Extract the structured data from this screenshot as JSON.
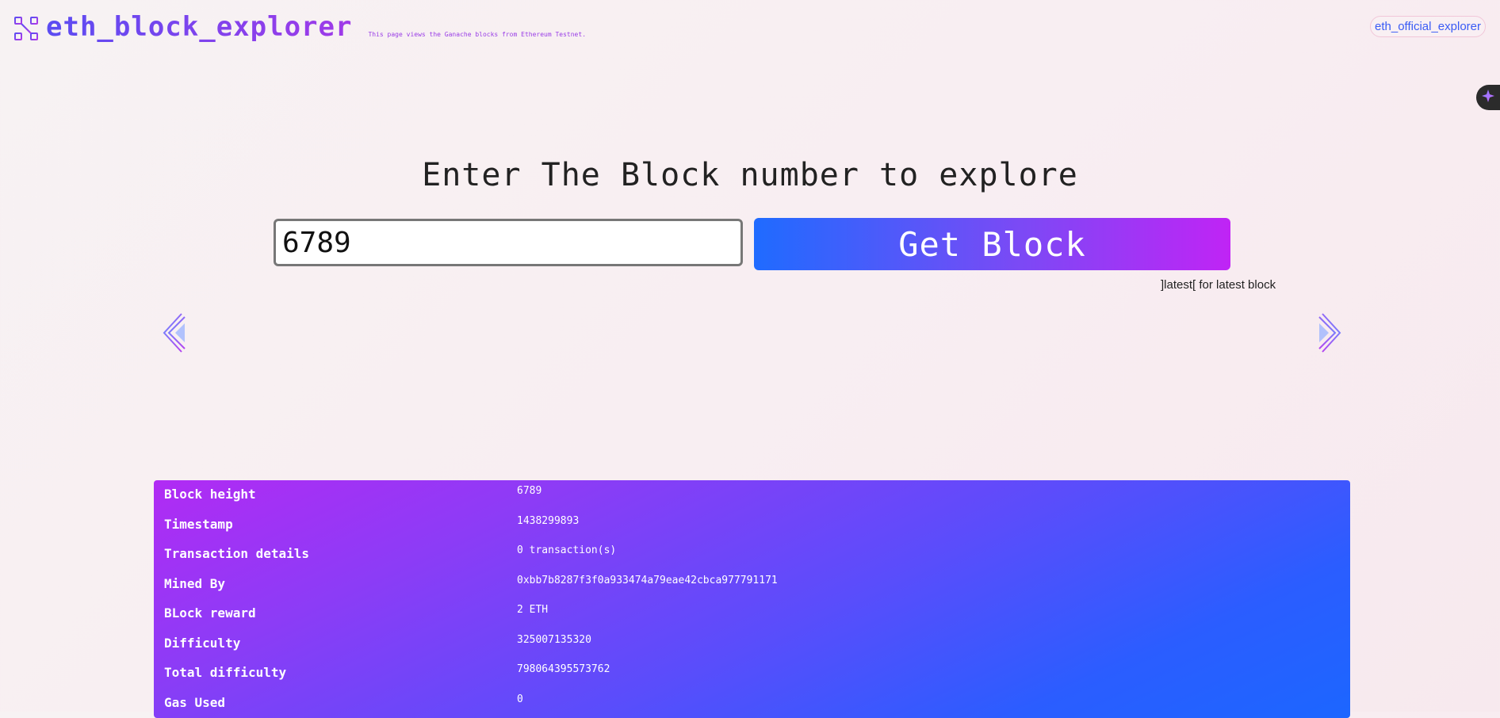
{
  "header": {
    "brand": "eth_block_explorer",
    "subtitle": "This page views the Ganache blocks from Ethereum Testnet.",
    "official_link": "eth_official_explorer"
  },
  "hero": {
    "title": "Enter The Block number to explore",
    "input_value": "6789",
    "button_label": "Get Block",
    "hint": "]latest[ for latest block"
  },
  "nav": {
    "prev_icon": "chevron-left-icon",
    "next_icon": "chevron-right-icon"
  },
  "block_info": [
    {
      "label": "Block height",
      "value": "6789"
    },
    {
      "label": "Timestamp",
      "value": "1438299893"
    },
    {
      "label": "Transaction details",
      "value": "0 transaction(s)"
    },
    {
      "label": "Mined By",
      "value": "0xbb7b8287f3f0a933474a79eae42cbca977791171"
    },
    {
      "label": "BLock reward",
      "value": "2 ETH"
    },
    {
      "label": "Difficulty",
      "value": "325007135320"
    },
    {
      "label": "Total difficulty",
      "value": "798064395573762"
    },
    {
      "label": "Gas Used",
      "value": "0"
    }
  ],
  "colors": {
    "brand_start": "#5b4cf2",
    "brand_end": "#a03ae8",
    "button_start": "#1f6bff",
    "button_end": "#c024f5",
    "panel_start": "#b12bf4",
    "panel_end": "#1c66ff"
  }
}
